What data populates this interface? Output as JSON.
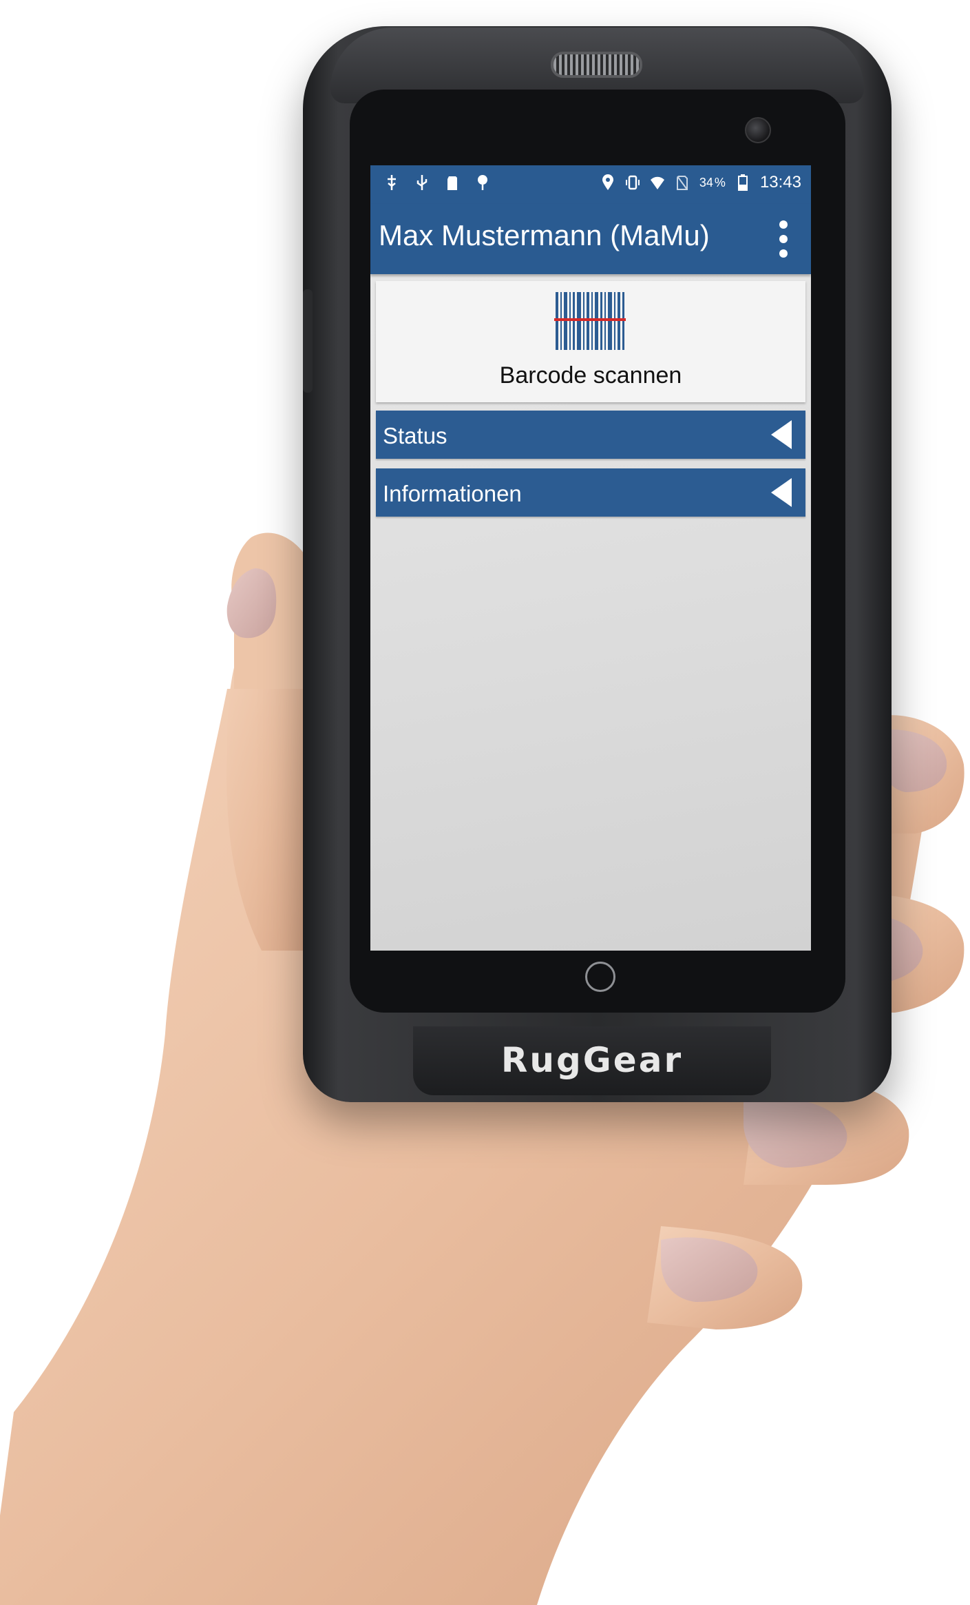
{
  "device": {
    "brand": "RugGear"
  },
  "status_bar": {
    "left_icons": [
      "usb-debug-icon",
      "usb-icon",
      "sd-card-icon",
      "location-pin-icon"
    ],
    "right_icons": [
      "location-icon",
      "vibrate-icon",
      "wifi-icon",
      "no-sim-icon"
    ],
    "battery_level": "34",
    "battery_percent_sign": "%",
    "time": "13:43",
    "background_color": "#2a5b91"
  },
  "app_bar": {
    "title": "Max Mustermann (MaMu)",
    "menu_icon": "overflow-menu-icon",
    "background_color": "#2a5b91"
  },
  "scan": {
    "icon": "barcode-icon",
    "label": "Barcode scannen"
  },
  "sections": [
    {
      "label": "Status",
      "icon": "collapse-arrow-icon"
    },
    {
      "label": "Informationen",
      "icon": "collapse-arrow-icon"
    }
  ],
  "nav": {
    "home_icon": "home-button-icon"
  }
}
